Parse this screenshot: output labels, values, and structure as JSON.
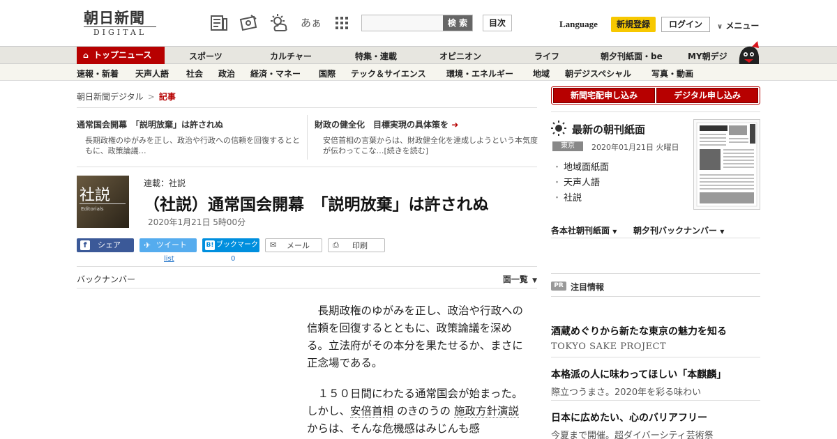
{
  "header": {
    "logo_main": "朝日新聞",
    "logo_sub": "DIGITAL",
    "hiragana_icon": "あぁ",
    "search_button": "検 索",
    "search_placeholder": "",
    "mokuji": "目次",
    "language": "Language",
    "signup": "新規登録",
    "login": "ログイン",
    "menu": "メニュー"
  },
  "nav": {
    "primary": [
      "トップニュース",
      "スポーツ",
      "カルチャー",
      "特集・連載",
      "オピニオン",
      "ライフ",
      "朝夕刊紙面・be",
      "MY朝デジ"
    ],
    "secondary": [
      "速報・新着",
      "天声人語",
      "社会",
      "政治",
      "経済・マネー",
      "国際",
      "テック＆サイエンス",
      "環境・エネルギー",
      "地域",
      "朝デジスペシャル",
      "写真・動画"
    ]
  },
  "breadcrumb": {
    "home": "朝日新聞デジタル",
    "sep": ">",
    "current": "記事"
  },
  "related": [
    {
      "title": "通常国会開幕　「説明放棄」は許されぬ",
      "desc": "長期政権のゆがみを正し、政治や行政への信頼を回復するとともに、政策論議…"
    },
    {
      "title": "財政の健全化　目標実現の具体策を",
      "desc": "安倍首相の言葉からは、財政健全化を達成しようという本気度が伝わってこな…[続きを読む]"
    }
  ],
  "article": {
    "thumb_text": "社説",
    "thumb_sub": "Editorials",
    "series": "連載：社説",
    "title": "（社説）通常国会開幕　「説明放棄」は許されぬ",
    "date": "2020年1月21日 5時00分",
    "share": {
      "facebook": "シェア",
      "twitter": "ツイート",
      "twitter_sub": "list",
      "hatena": "ブックマーク",
      "hatena_sub": "0",
      "mail": "メール",
      "print": "印刷"
    },
    "backnumber": "バックナンバー",
    "page_list": "面一覧",
    "p1": "長期政権のゆがみを正し、政治や行政への信頼を回復するとともに、政策論議を深める。立法府がその本分を果たせるか、まさに正念場である。",
    "p2a": "１５０日間にわたる通常国会が始まった。しかし、",
    "p2_link1": "安倍首相",
    "p2b": "のきのうの",
    "p2_link2": "施政方針演説",
    "p2c": "からは、そんな危機感はみじんも感"
  },
  "right": {
    "btn_home": "新聞宅配申し込み",
    "btn_digital": "デジタル申し込み",
    "latest_title": "最新の朝刊紙面",
    "region": "東京",
    "latest_date": "2020年01月21日 火曜日",
    "latest_items": [
      "地域面紙面",
      "天声人語",
      "社説"
    ],
    "sub_left": "各本社朝刊紙面",
    "sub_right": "朝夕刊バックナンバー",
    "pr_badge": "PR",
    "pr_title": "注目情報",
    "ads": [
      {
        "title": "酒蔵めぐりから新たな東京の魅力を知る",
        "sub": "TOKYO SAKE PROJECT"
      },
      {
        "title": "本格派の人に味わってほしい「本麒麟」",
        "sub": "際立つうまさ。2020年を彩る味わい"
      },
      {
        "title": "日本に広めたい、心のバリアフリー",
        "sub": "今夏まで開催。超ダイバーシティ芸術祭"
      }
    ]
  },
  "colors": {
    "brand_red": "#b70000",
    "signup_yellow": "#f7c800",
    "nav_bg": "#e7e6e0"
  }
}
